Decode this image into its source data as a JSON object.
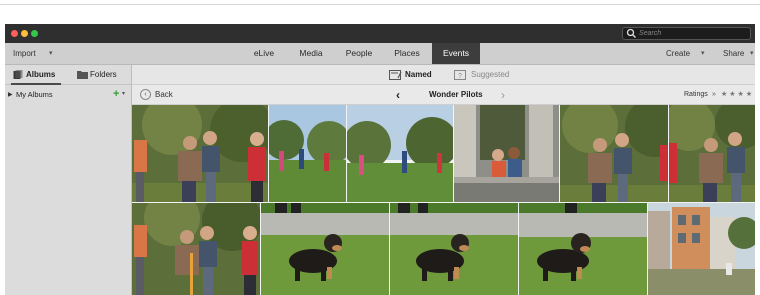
{
  "window": {
    "traffic_lights": [
      "#fc605b",
      "#fdbc40",
      "#34c84a"
    ],
    "search": {
      "placeholder": "Search",
      "icon": "search-icon"
    }
  },
  "menubar": {
    "import_label": "Import",
    "tabs": [
      {
        "label": "eLive",
        "active": false
      },
      {
        "label": "Media",
        "active": false
      },
      {
        "label": "People",
        "active": false
      },
      {
        "label": "Places",
        "active": false
      },
      {
        "label": "Events",
        "active": true
      }
    ],
    "create_label": "Create",
    "share_label": "Share"
  },
  "sidebar": {
    "tabs": [
      {
        "label": "Albums",
        "icon": "albums-icon",
        "active": true
      },
      {
        "label": "Folders",
        "icon": "folder-icon",
        "active": false
      }
    ],
    "my_albums_label": "My Albums",
    "add_icon": "plus-icon"
  },
  "subbar": {
    "named_label": "Named",
    "suggested_label": "Suggested"
  },
  "navbar": {
    "back_label": "Back",
    "event_title": "Wonder Pilots",
    "ratings_label": "Ratings",
    "rating_stars": 5
  },
  "photos": [
    {
      "subject": "kids-posing-park"
    },
    {
      "subject": "kids-playing-field"
    },
    {
      "subject": "kids-playing-field-wide"
    },
    {
      "subject": "family-on-steps"
    },
    {
      "subject": "kids-posing-park-2"
    },
    {
      "subject": "kids-posing-park-3"
    },
    {
      "subject": "kids-posing-park-4"
    },
    {
      "subject": "dog-on-grass"
    },
    {
      "subject": "dog-on-grass-2"
    },
    {
      "subject": "dog-on-grass-3"
    },
    {
      "subject": "houses-street"
    }
  ]
}
